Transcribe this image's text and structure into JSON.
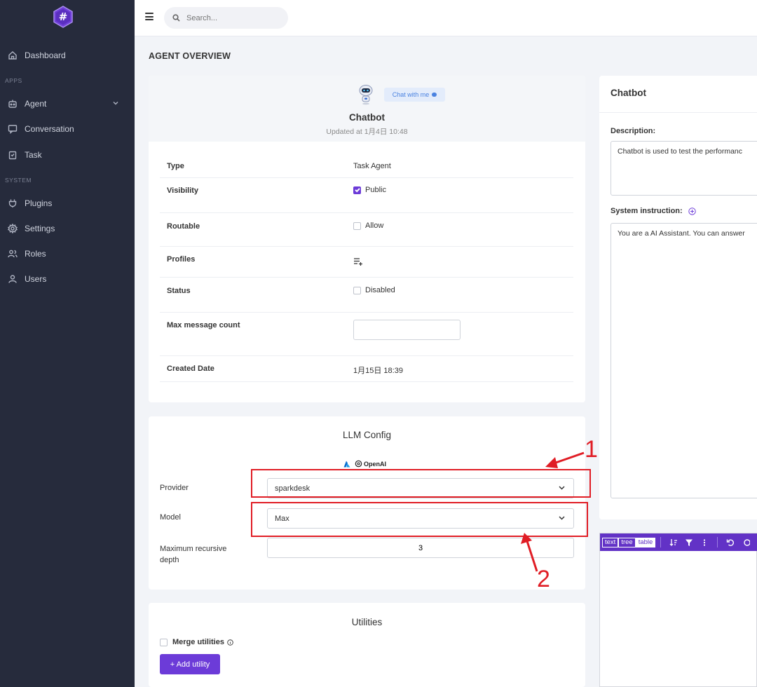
{
  "sidebar": {
    "items": [
      {
        "label": "Dashboard",
        "icon": "home-icon"
      },
      {
        "label": "Agent",
        "icon": "robot-icon"
      },
      {
        "label": "Conversation",
        "icon": "chat-icon"
      },
      {
        "label": "Task",
        "icon": "clipboard-icon"
      },
      {
        "label": "Plugins",
        "icon": "plug-icon"
      },
      {
        "label": "Settings",
        "icon": "gear-icon"
      },
      {
        "label": "Roles",
        "icon": "roles-icon"
      },
      {
        "label": "Users",
        "icon": "user-icon"
      }
    ],
    "sections": {
      "apps": "APPS",
      "system": "SYSTEM"
    }
  },
  "topbar": {
    "search_placeholder": "Search..."
  },
  "page": {
    "title": "AGENT OVERVIEW"
  },
  "agent": {
    "chat_button": "Chat with me",
    "name": "Chatbot",
    "updated": "Updated at 1月4日 10:48"
  },
  "details": {
    "type_label": "Type",
    "type_value": "Task Agent",
    "visibility_label": "Visibility",
    "visibility_value": "Public",
    "visibility_checked": true,
    "routable_label": "Routable",
    "routable_value": "Allow",
    "routable_checked": false,
    "profiles_label": "Profiles",
    "status_label": "Status",
    "status_value": "Disabled",
    "status_checked": false,
    "max_msg_label": "Max message count",
    "max_msg_value": "",
    "created_label": "Created Date",
    "created_value": "1月15日 18:39"
  },
  "llm": {
    "title": "LLM Config",
    "openai_label": "OpenAI",
    "provider_label": "Provider",
    "provider_value": "sparkdesk",
    "model_label": "Model",
    "model_value": "Max",
    "depth_label_1": "Maximum recursive",
    "depth_label_2": "depth",
    "depth_value": "3"
  },
  "utilities": {
    "title": "Utilities",
    "merge_label": "Merge utilities",
    "add_button": "+ Add utility"
  },
  "right": {
    "title": "Chatbot",
    "description_label": "Description:",
    "description_value": "Chatbot is used to test the performanc",
    "instruction_label": "System instruction:",
    "instruction_value": "You are a AI Assistant. You can answer"
  },
  "json_editor": {
    "modes": [
      "text",
      "tree",
      "table"
    ],
    "active_mode": "table"
  },
  "annotations": {
    "label_1": "1",
    "label_2": "2",
    "color": "#e01d25"
  },
  "colors": {
    "sidebar_bg": "#262b3c",
    "accent": "#6c3bd8",
    "json_bar": "#6232c6"
  }
}
